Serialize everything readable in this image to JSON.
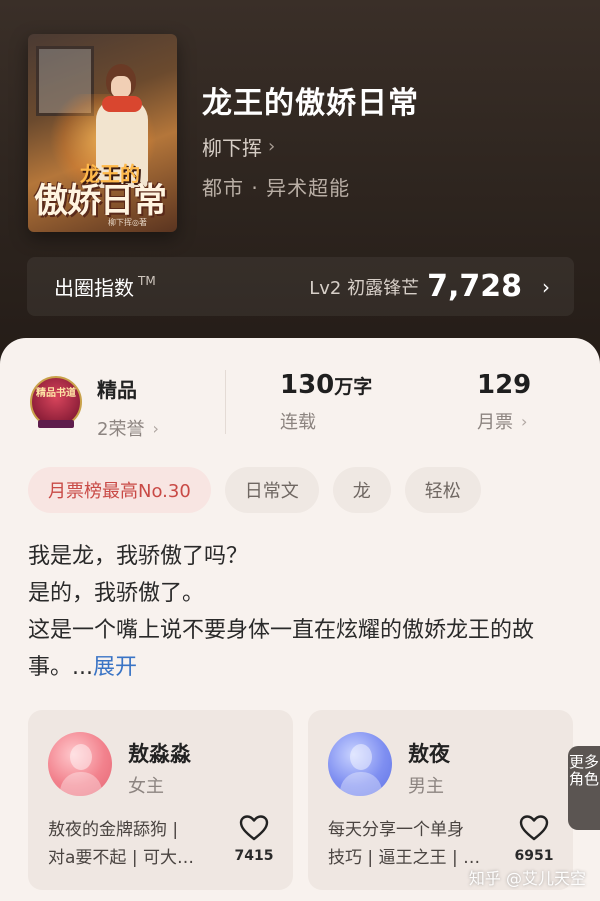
{
  "book": {
    "title": "龙王的傲娇日常",
    "author": "柳下挥",
    "genre": "都市 · 异术超能",
    "cover": {
      "title_small": "龙王的",
      "title_big": "傲娇日常",
      "author_credit": "柳下挥◎著"
    }
  },
  "index_bar": {
    "label": "出圈指数",
    "tm": "TM",
    "level": "Lv2 初露锋芒",
    "score": "7,728"
  },
  "stats": {
    "badge_text": "精品书道",
    "quality": "精品",
    "honors": "2荣誉",
    "words_num": "130",
    "words_unit": "万字",
    "status": "连载",
    "tickets_num": "129",
    "tickets_label": "月票"
  },
  "tags": [
    {
      "label": "月票榜最高No.30",
      "hot": true
    },
    {
      "label": "日常文",
      "hot": false
    },
    {
      "label": "龙",
      "hot": false
    },
    {
      "label": "轻松",
      "hot": false
    }
  ],
  "description": {
    "line1": "我是龙，我骄傲了吗？",
    "line2": "是的，我骄傲了。",
    "line3": "这是一个嘴上说不要身体一直在炫耀的傲娇龙王的故事。...",
    "expand": "展开"
  },
  "characters": [
    {
      "name": "敖淼淼",
      "role": "女主",
      "bio_line1": "敖夜的金牌舔狗 |",
      "bio_line2": "对a要不起 | 可大…",
      "likes": "7415"
    },
    {
      "name": "敖夜",
      "role": "男主",
      "bio_line1": "每天分享一个单身",
      "bio_line2": "技巧 | 逼王之王 | …",
      "likes": "6951"
    }
  ],
  "more_roles": "更多角色",
  "watermark": "知乎 @艾儿天空",
  "colors": {
    "header_bg": "#2f2620",
    "card_bg": "#f8f2ee",
    "tag_hot_text": "#c94a46",
    "expand_link": "#3a74c5"
  },
  "icons": {
    "author_chevron": "chevron-right-icon",
    "index_chevron": "chevron-right-icon",
    "like": "heart-outline-icon",
    "badge": "quality-badge-icon"
  }
}
